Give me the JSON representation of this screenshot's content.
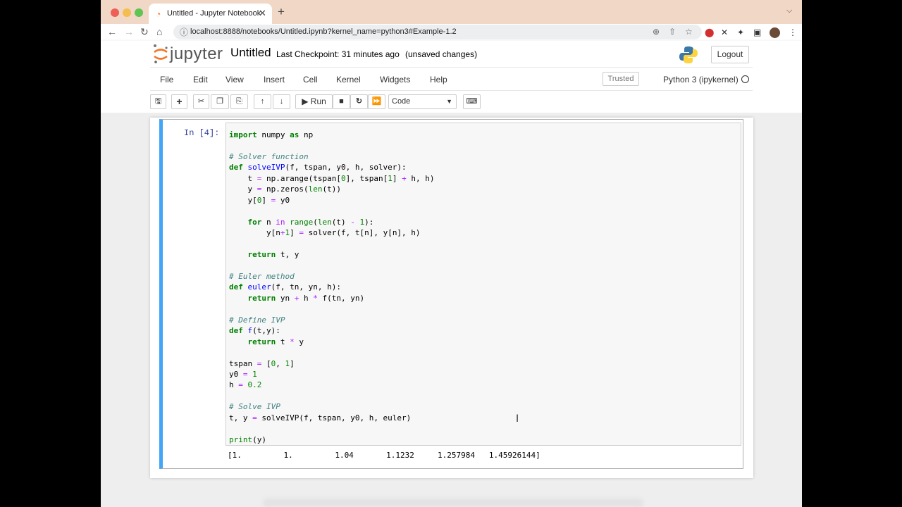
{
  "browser": {
    "tab_title": "Untitled - Jupyter Notebook",
    "url": "localhost:8888/notebooks/Untitled.ipynb?kernel_name=python3#Example-1.2"
  },
  "header": {
    "logo_text": "jupyter",
    "notebook_name": "Untitled",
    "checkpoint": "Last Checkpoint: 31 minutes ago",
    "save_status": "(unsaved changes)",
    "logout_label": "Logout"
  },
  "menu": {
    "items": [
      "File",
      "Edit",
      "View",
      "Insert",
      "Cell",
      "Kernel",
      "Widgets",
      "Help"
    ],
    "trusted": "Trusted",
    "kernel_name": "Python 3 (ipykernel)"
  },
  "toolbar": {
    "run_label": "Run",
    "cell_type": "Code"
  },
  "cell": {
    "prompt": "In [4]:",
    "output": "[1.         1.         1.04       1.1232     1.257984   1.45926144]"
  }
}
